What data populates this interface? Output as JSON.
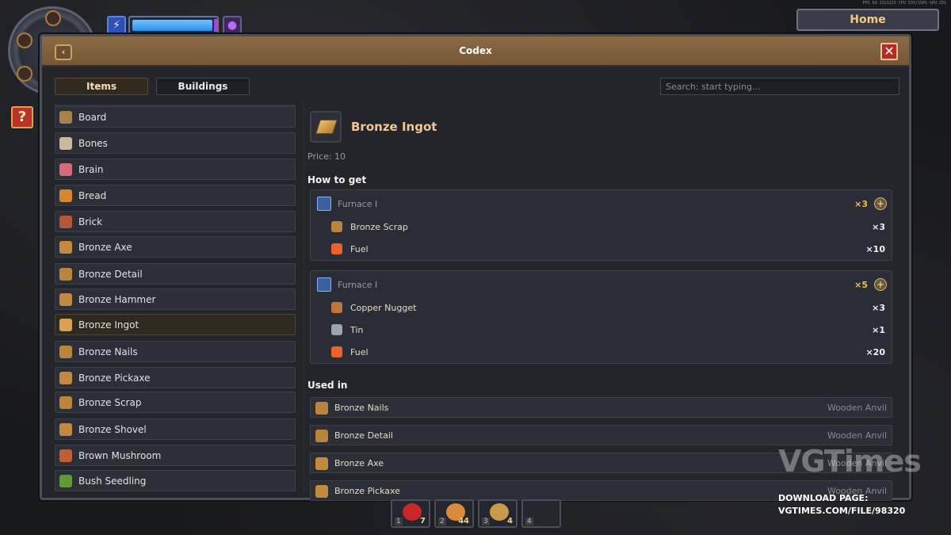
{
  "hud": {
    "energy_icon": "lightning-icon",
    "orb_icon": "purple-orb-icon",
    "help_label": "?",
    "energy_level": 0.97
  },
  "debug_text": "FPS 60   1321223   CPU 53%/150%   GPU 25%",
  "home_button": "Home",
  "window": {
    "title": "Codex",
    "back_label": "‹",
    "close_label": "✕"
  },
  "tabs": [
    {
      "label": "Items",
      "active": true
    },
    {
      "label": "Buildings",
      "active": false
    }
  ],
  "search": {
    "placeholder": "Search: start typing..."
  },
  "items": [
    {
      "label": "Board",
      "icon": "board-icon",
      "color": "#a7824e"
    },
    {
      "label": "Bones",
      "icon": "bones-icon",
      "color": "#c9b89a"
    },
    {
      "label": "Brain",
      "icon": "brain-icon",
      "color": "#d46a7a"
    },
    {
      "label": "Bread",
      "icon": "bread-icon",
      "color": "#d8862e"
    },
    {
      "label": "Brick",
      "icon": "brick-icon",
      "color": "#b5553a"
    },
    {
      "label": "Bronze Axe",
      "icon": "axe-icon",
      "color": "#c28a3e"
    },
    {
      "label": "Bronze Detail",
      "icon": "detail-icon",
      "color": "#b9843c"
    },
    {
      "label": "Bronze Hammer",
      "icon": "hammer-icon",
      "color": "#c28a3e"
    },
    {
      "label": "Bronze Ingot",
      "icon": "ingot-icon",
      "color": "#d9a052",
      "selected": true
    },
    {
      "label": "Bronze Nails",
      "icon": "nails-icon",
      "color": "#b9843c"
    },
    {
      "label": "Bronze Pickaxe",
      "icon": "pickaxe-icon",
      "color": "#c28a3e"
    },
    {
      "label": "Bronze Scrap",
      "icon": "scrap-icon",
      "color": "#b9843c"
    },
    {
      "label": "Bronze Shovel",
      "icon": "shovel-icon",
      "color": "#c28a3e"
    },
    {
      "label": "Brown Mushroom",
      "icon": "mushroom-icon",
      "color": "#c0602e"
    },
    {
      "label": "Bush Seedling",
      "icon": "seedling-icon",
      "color": "#5e9a3a"
    }
  ],
  "detail": {
    "title": "Bronze Ingot",
    "price": "Price: 10",
    "how_to_get": "How to get",
    "used_in": "Used in",
    "recipes": [
      {
        "station": "Furnace I",
        "yield": "×3",
        "ingredients": [
          {
            "label": "Bronze Scrap",
            "qty": "×3",
            "icon": "scrap-icon",
            "color": "#b9843c"
          },
          {
            "label": "Fuel",
            "qty": "×10",
            "icon": "fire-icon",
            "color": "#e8642a"
          }
        ]
      },
      {
        "station": "Furnace I",
        "yield": "×5",
        "ingredients": [
          {
            "label": "Copper Nugget",
            "qty": "×3",
            "icon": "nugget-icon",
            "color": "#c0733a"
          },
          {
            "label": "Tin",
            "qty": "×1",
            "icon": "tin-icon",
            "color": "#9ea3ad"
          },
          {
            "label": "Fuel",
            "qty": "×20",
            "icon": "fire-icon",
            "color": "#e8642a"
          }
        ]
      }
    ],
    "uses": [
      {
        "label": "Bronze Nails",
        "station": "Wooden Anvil",
        "icon": "nails-icon",
        "color": "#b9843c"
      },
      {
        "label": "Bronze Detail",
        "station": "Wooden Anvil",
        "icon": "detail-icon",
        "color": "#b9843c"
      },
      {
        "label": "Bronze Axe",
        "station": "Wooden Anvil",
        "icon": "axe-icon",
        "color": "#c28a3e"
      },
      {
        "label": "Bronze Pickaxe",
        "station": "Wooden Anvil",
        "icon": "pickaxe-icon",
        "color": "#c28a3e"
      }
    ]
  },
  "hotbar": [
    {
      "num": "1",
      "count": "7",
      "icon": "berries-icon",
      "color": "#c8282a"
    },
    {
      "num": "2",
      "count": "44",
      "icon": "pie-icon",
      "color": "#d98a3a"
    },
    {
      "num": "3",
      "count": "4",
      "icon": "fish-icon",
      "color": "#c89a4a"
    },
    {
      "num": "4",
      "count": "",
      "icon": "",
      "color": ""
    }
  ],
  "watermark": {
    "logo": "VGTimes",
    "line1": "DOWNLOAD PAGE:",
    "line2": "VGTIMES.COM/FILE/98320"
  }
}
